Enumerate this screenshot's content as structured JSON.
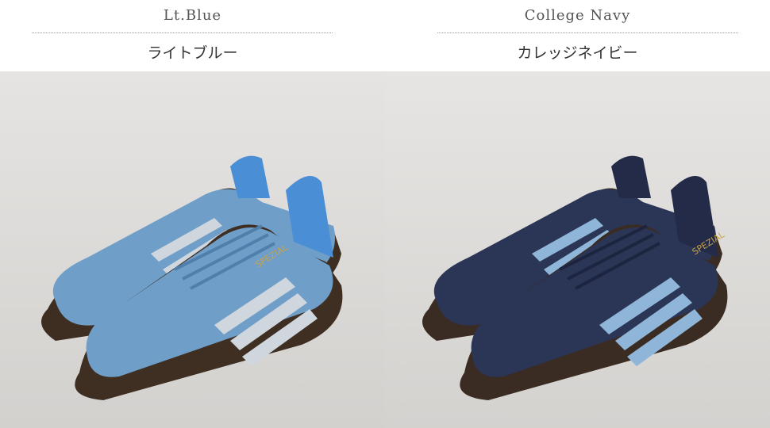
{
  "panels": [
    {
      "label_en": "Lt.Blue",
      "label_jp": "ライトブルー",
      "photo_desc": "light-blue-sneakers-photo",
      "colors": {
        "upper": "#6f9ec8",
        "upper_dark": "#4f7fac",
        "stripe": "#cfd6de",
        "sole": "#3f2e22",
        "lining": "#4a8ed6"
      }
    },
    {
      "label_en": "College Navy",
      "label_jp": "カレッジネイビー",
      "photo_desc": "navy-sneakers-photo",
      "colors": {
        "upper": "#2b3556",
        "upper_dark": "#1c2440",
        "stripe": "#8fb6d8",
        "sole": "#3a2c22",
        "lining": "#232b48"
      }
    }
  ],
  "brand_text": "SPEZIAL"
}
